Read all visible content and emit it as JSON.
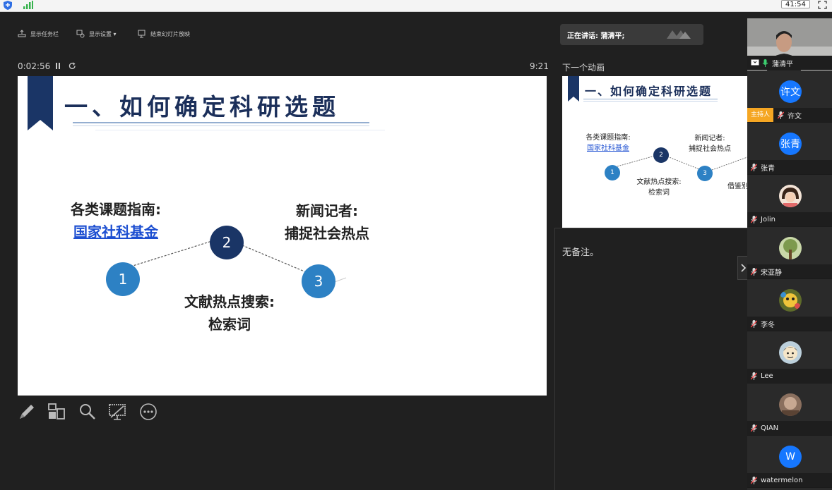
{
  "system": {
    "timer": "41:54"
  },
  "toolbar": {
    "show_taskbar": "显示任务栏",
    "display_settings": "显示设置 ▾",
    "end_slideshow": "结束幻灯片放映"
  },
  "speaker": {
    "label": "正在讲话: 蒲清平;"
  },
  "timing": {
    "elapsed": "0:02:56",
    "clock": "9:21"
  },
  "next_panel": {
    "label": "下一个动画"
  },
  "slide": {
    "title": "一、如何确定科研选题",
    "circles": [
      "1",
      "2",
      "3"
    ],
    "label_a_line1": "各类课题指南:",
    "label_a_link": "国家社科基金",
    "label_b_line1": "新闻记者:",
    "label_b_line2": "捕捉社会热点",
    "label_c_line1": "文献热点搜索:",
    "label_c_line2": "检索词"
  },
  "preview": {
    "title": "一、如何确定科研选题",
    "label_a_line1": "各类课题指南:",
    "label_a_link": "国家社科基金",
    "label_b_line1": "新闻记者:",
    "label_b_line2": "捕捉社会热点",
    "label_c_line1": "文献热点搜索:",
    "label_c_line2": "检索词",
    "label_d": "借鉴别",
    "circles": [
      "1",
      "2",
      "3"
    ]
  },
  "notes": {
    "text": "无备注。"
  },
  "participants": [
    {
      "name": "蒲清平",
      "type": "video"
    },
    {
      "name": "许文",
      "avatar_text": "许文",
      "avatar_color": "#1677ff",
      "host_badge": "主持人"
    },
    {
      "name": "张青",
      "avatar_text": "张青",
      "avatar_color": "#1677ff"
    },
    {
      "name": "Jolin",
      "avatar_color": "#f3d8c4"
    },
    {
      "name": "宋亚静",
      "avatar_color": "#9bb077"
    },
    {
      "name": "李冬",
      "avatar_color": "#7b8a3a"
    },
    {
      "name": "Lee",
      "avatar_color": "#c9d6e0"
    },
    {
      "name": "QIAN",
      "avatar_color": "#b59a86"
    },
    {
      "name": "watermelon",
      "avatar_text": "W",
      "avatar_color": "#1677ff"
    }
  ],
  "colors": {
    "slide_navy": "#1a3566",
    "slide_blue": "#2d81c4",
    "link": "#1d4fd1",
    "host_badge": "#f5a623",
    "avatar_blue": "#1677ff"
  }
}
